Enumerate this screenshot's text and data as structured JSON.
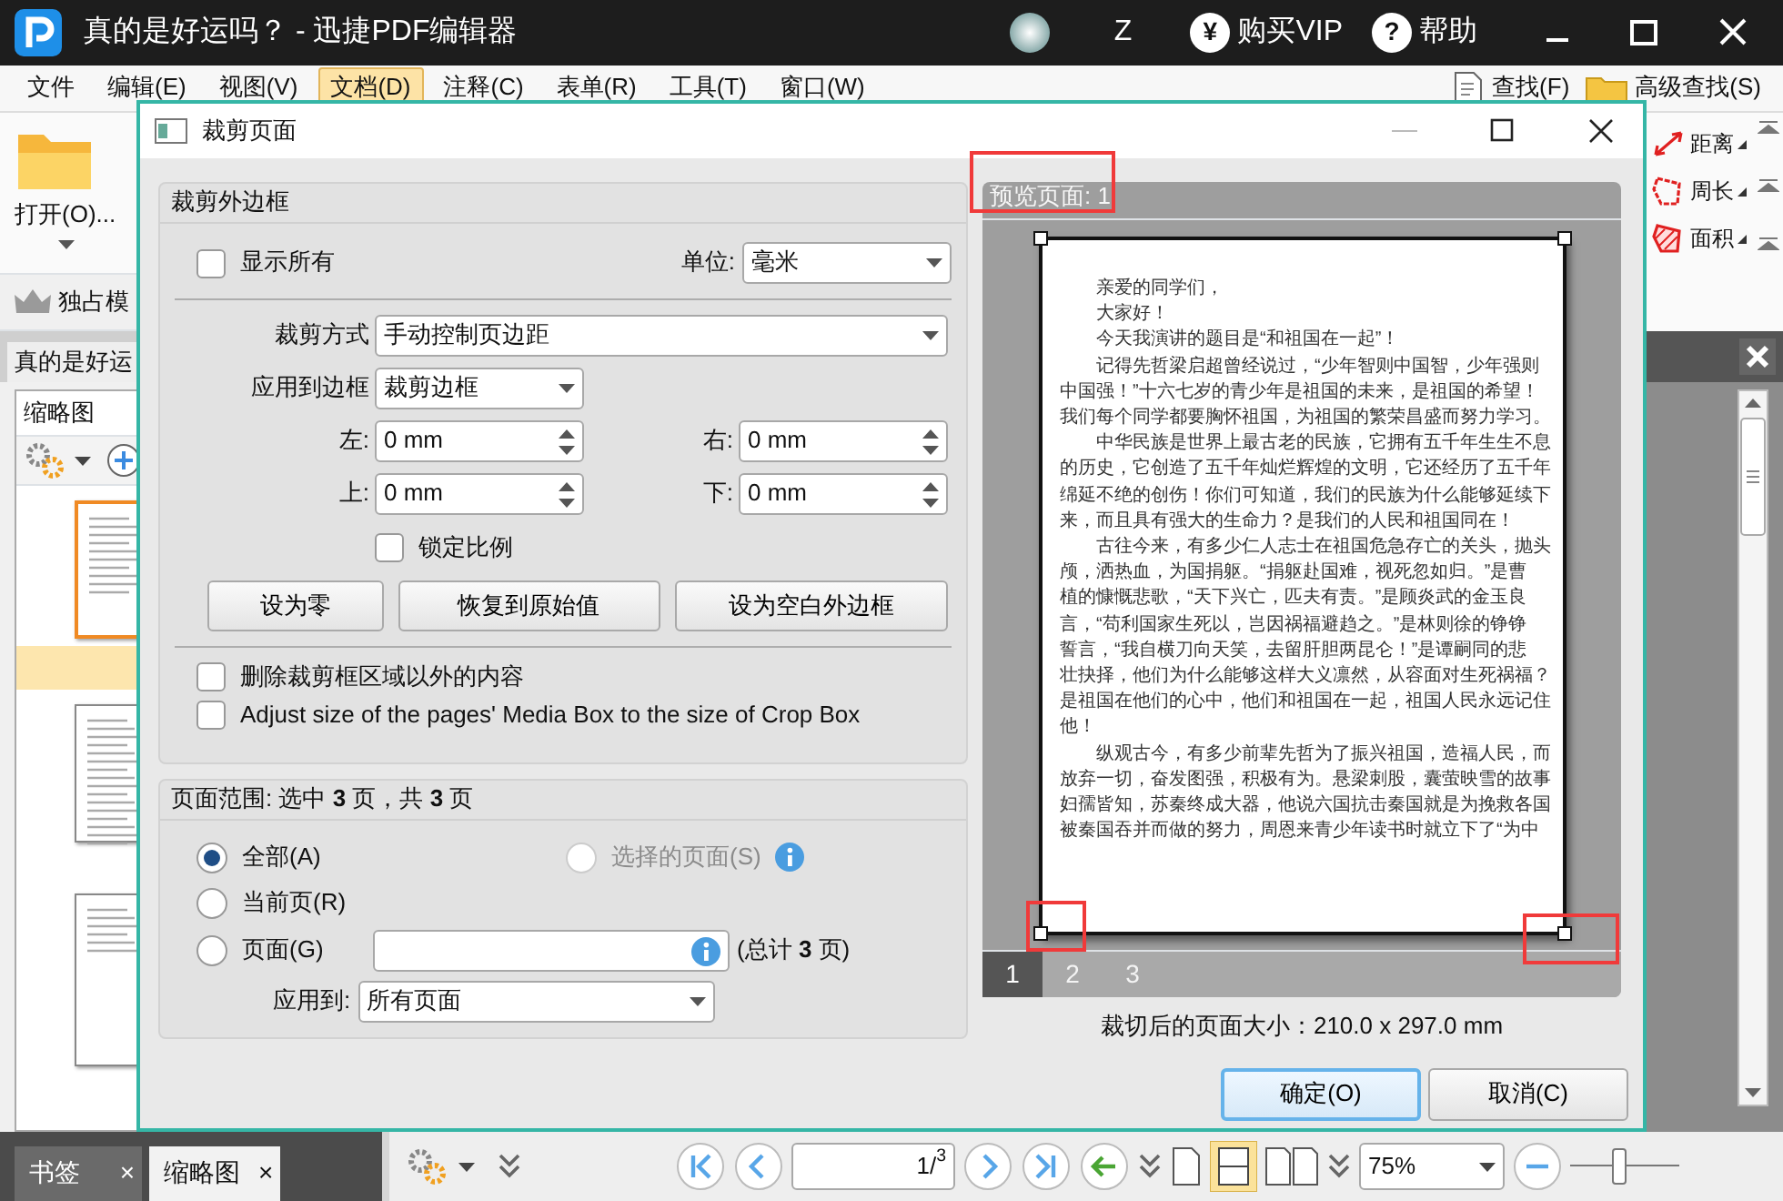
{
  "app": {
    "title": "真的是好运吗？ - 迅捷PDF编辑器",
    "user_initial": "Z",
    "vip": {
      "icon": "¥",
      "label": "购买VIP"
    },
    "help": {
      "icon": "?",
      "label": "帮助"
    }
  },
  "menu": [
    {
      "label": "文件",
      "selected": false
    },
    {
      "label": "编辑(E)",
      "selected": false
    },
    {
      "label": "视图(V)",
      "selected": false
    },
    {
      "label": "文档(D)",
      "selected": true
    },
    {
      "label": "注释(C)",
      "selected": false
    },
    {
      "label": "表单(R)",
      "selected": false
    },
    {
      "label": "工具(T)",
      "selected": false
    },
    {
      "label": "窗口(W)",
      "selected": false
    }
  ],
  "search_tools": [
    {
      "label": "查找(F)",
      "kind": "find"
    },
    {
      "label": "高级查找(S)",
      "kind": "advanced"
    }
  ],
  "ribbon": {
    "open_label": "打开(O)...",
    "exclusive_mode": "独占模"
  },
  "document_tab": "真的是好运",
  "thumbnail_panel": {
    "title": "缩略图",
    "thumbnails": [
      {
        "selected": true
      },
      {
        "selected": false
      },
      {
        "selected": false
      }
    ]
  },
  "measure_tools": [
    {
      "label": "距离",
      "kind": "distance"
    },
    {
      "label": "周长",
      "kind": "perimeter"
    },
    {
      "label": "面积",
      "kind": "area"
    }
  ],
  "bottom_bar": {
    "panel_tabs": [
      {
        "label": "书签",
        "selected": false,
        "close": "×"
      },
      {
        "label": "缩略图",
        "selected": true,
        "close": "×"
      }
    ],
    "page": "1/$^{3}$",
    "zoom": "75%",
    "zoom_slider": {
      "level": 0.45
    }
  },
  "dialog": {
    "title": "裁剪页面",
    "margins_group": {
      "title": "裁剪外边框",
      "show_all": {
        "label": "显示所有",
        "checked": false
      },
      "unit": {
        "label": "单位:",
        "value": "毫米"
      },
      "crop_mode": {
        "label": "裁剪方式",
        "value": "手动控制页边距"
      },
      "apply_to_box": {
        "label": "应用到边框",
        "value": "裁剪边框"
      },
      "margins": [
        {
          "label": "左:",
          "value": "0 mm"
        },
        {
          "label": "右:",
          "value": "0 mm"
        },
        {
          "label": "上:",
          "value": "0 mm"
        },
        {
          "label": "下:",
          "value": "0 mm"
        }
      ],
      "lock_ratio": {
        "label": "锁定比例",
        "checked": false
      },
      "buttons": [
        "设为零",
        "恢复到原始值",
        "设为空白外边框"
      ],
      "options": [
        {
          "label": "删除裁剪框区域以外的内容",
          "checked": false
        },
        {
          "label": "Adjust size of the pages' Media Box to the size of Crop Box",
          "checked": false
        }
      ]
    },
    "page_range": {
      "title": "页面范围: 选中 **3** 页，共 **3** 页",
      "choices": [
        {
          "label": "全部(A)",
          "selected": true,
          "disabled": false
        },
        {
          "label": "选择的页面(S)",
          "selected": false,
          "disabled": true,
          "info": true
        },
        {
          "label": "当前页(R)",
          "selected": false,
          "disabled": false
        },
        {
          "label": "页面(G)",
          "selected": false,
          "disabled": false
        }
      ],
      "total": "(总计 **3** 页)",
      "apply_to": {
        "label": "应用到:",
        "value": "所有页面"
      }
    },
    "preview": {
      "title": "预览页面: 1",
      "paragraphs": [
        [
          "亲爱的同学们，"
        ],
        [
          "大家好！"
        ],
        [
          "今天我演讲的题目是“和祖国在一起”！"
        ],
        [
          "记得先哲梁启超曾经说过，“少年智则中国智，少年强则",
          "中国强！”十六七岁的青少年是祖国的未来，是祖国的希望！",
          "我们每个同学都要胸怀祖国，为祖国的繁荣昌盛而努力学习。"
        ],
        [
          "中华民族是世界上最古老的民族，它拥有五千年生生不息",
          "的历史，它创造了五千年灿烂辉煌的文明，它还经历了五千年",
          "绵延不绝的创伤！你们可知道，我们的民族为什么能够延续下",
          "来，而且具有强大的生命力？是我们的人民和祖国同在！"
        ],
        [
          "古往今来，有多少仁人志士在祖国危急存亡的关头，抛头",
          "颅，洒热血，为国捐躯。“捐躯赴国难，视死忽如归。”是曹",
          "植的慷慨悲歌，“天下兴亡，匹夫有责。”是顾炎武的金玉良",
          "言，“苟利国家生死以，岂因祸福避趋之。”是林则徐的铮铮",
          "誓言，“我自横刀向天笑，去留肝胆两昆仑！”是谭嗣同的悲",
          "壮抉择，他们为什么能够这样大义凛然，从容面对生死祸福？",
          "是祖国在他们的心中，他们和祖国在一起，祖国人民永远记住",
          "他！"
        ],
        [
          "纵观古今，有多少前辈先哲为了振兴祖国，造福人民，而",
          "放弃一切，奋发图强，积极有为。悬梁刺股，囊萤映雪的故事",
          "妇孺皆知，苏秦终成大器，他说六国抗击秦国就是为挽救各国",
          "被秦国吞并而做的努力，周恩来青少年读书时就立下了“为中"
        ]
      ],
      "page_tabs": [
        {
          "label": "1",
          "selected": true
        },
        {
          "label": "2",
          "selected": false
        },
        {
          "label": "3",
          "selected": false
        }
      ],
      "size": "裁切后的页面大小：210.0 x 297.0 mm"
    },
    "buttons": [
      {
        "label": "确定(O)",
        "kind": "primary"
      },
      {
        "label": "取消(C)",
        "kind": "secondary"
      }
    ],
    "highlight_boxes": [
      {
        "kind": "preview-title"
      },
      {
        "kind": "bottom-left-handle"
      },
      {
        "kind": "bottom-right-handle"
      }
    ]
  }
}
